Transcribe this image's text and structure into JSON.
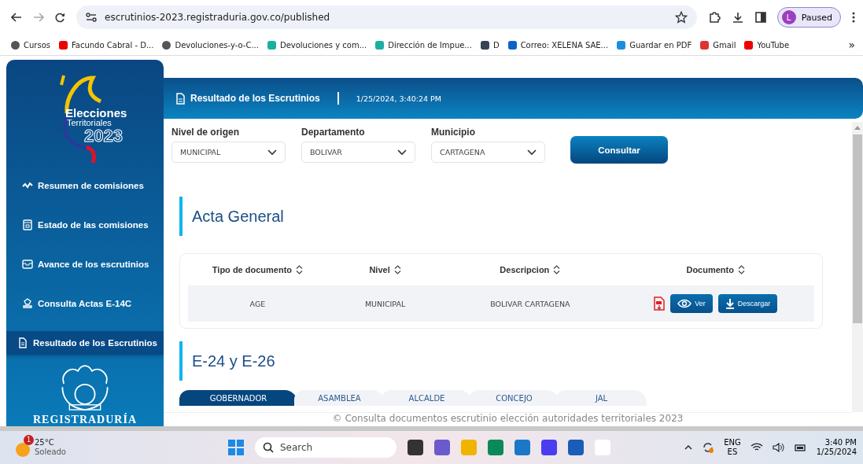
{
  "browser": {
    "url": "escrutinios-2023.registraduria.gov.co/published",
    "profile_initial": "L",
    "profile_status": "Paused",
    "more": "»",
    "bookmarks": [
      {
        "label": "Cursos",
        "kind": "globe"
      },
      {
        "label": "Facundo Cabral - D...",
        "kind": "video"
      },
      {
        "label": "Devoluciones-y-o-C...",
        "kind": "globe"
      },
      {
        "label": "Devoluciones y com...",
        "kind": "teal"
      },
      {
        "label": "Dirección de Impue...",
        "kind": "teal"
      },
      {
        "label": "D",
        "kind": "doc"
      },
      {
        "label": "Correo: XELENA SAE...",
        "kind": "mail"
      },
      {
        "label": "Guardar en PDF",
        "kind": "cloud"
      },
      {
        "label": "Gmail",
        "kind": "gmail"
      },
      {
        "label": "YouTube",
        "kind": "video"
      }
    ]
  },
  "sidebar": {
    "logo": {
      "title": "Elecciones",
      "subtitle": "Territoriales",
      "year": "2023"
    },
    "items": [
      {
        "label": "Resumen de comisiones",
        "kind": "pulse",
        "selected": false
      },
      {
        "label": "Estado de las comisiones",
        "kind": "box",
        "selected": false
      },
      {
        "label": "Avance de los escrutinios",
        "kind": "inbox",
        "selected": false
      },
      {
        "label": "Consulta Actas E-14C",
        "kind": "stamp",
        "selected": false
      },
      {
        "label": "Resultado de los Escrutinios",
        "kind": "doc",
        "selected": true
      }
    ],
    "footer_logo": "REGISTRADURÍA"
  },
  "header": {
    "title": "Resultado de los Escrutinios",
    "datetime": "1/25/2024, 3:40:24 PM"
  },
  "filters": [
    {
      "label": "Nivel de origen",
      "value": "MUNICIPAL"
    },
    {
      "label": "Departamento",
      "value": "BOLIVAR"
    },
    {
      "label": "Municipio",
      "value": "CARTAGENA"
    }
  ],
  "consult_button": "Consultar",
  "acta_general": {
    "title": "Acta General",
    "columns": [
      "Tipo de documento",
      "Nivel",
      "Descripcion",
      "Documento"
    ],
    "rows": [
      {
        "cells": [
          "AGE",
          "MUNICIPAL",
          "BOLIVAR CARTAGENA"
        ],
        "view": "Ver",
        "download": "Descargar"
      }
    ]
  },
  "e24": {
    "title": "E-24 y E-26",
    "tabs": [
      {
        "label": "GOBERNADOR",
        "selected": true
      },
      {
        "label": "ASAMBLEA",
        "selected": false
      },
      {
        "label": "ALCALDE",
        "selected": false
      },
      {
        "label": "CONCEJO",
        "selected": false
      },
      {
        "label": "JAL",
        "selected": false
      }
    ]
  },
  "footer": "© Consulta documentos escrutinio elección autoridades territoriales 2023",
  "taskbar": {
    "weather_badge": "1",
    "temperature": "25°C",
    "condition": "Soleado",
    "search": "Search",
    "lang": "ENG",
    "region": "ES",
    "time": "3:40 PM",
    "date": "1/25/2024"
  }
}
